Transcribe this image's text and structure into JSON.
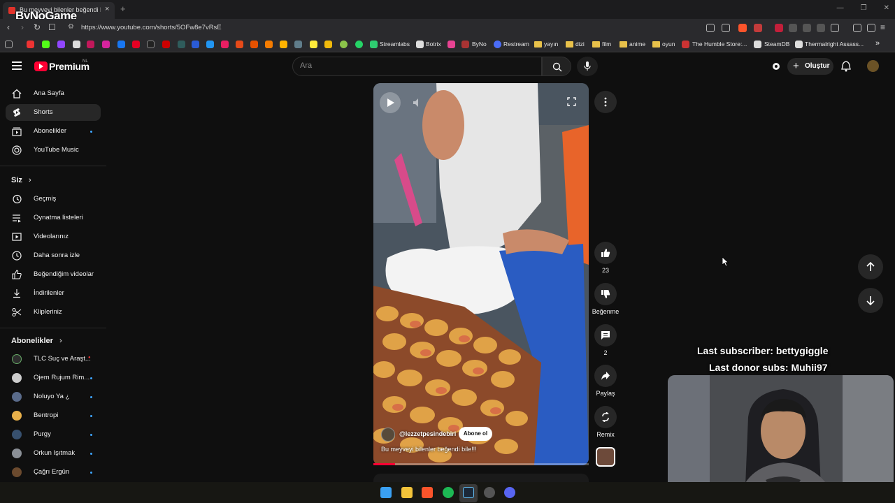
{
  "browser": {
    "tab_title": "Bu meyveyi bilenler beğendi bile!!! - YouTube",
    "tab_close": "×",
    "new_tab": "+",
    "overlay_brand": "ByNoGame",
    "url": "https://www.youtube.com/shorts/5OFw8e7vRsE",
    "window_controls": [
      "—",
      "❐",
      "✕"
    ]
  },
  "bookmarks": [
    {
      "label": "Streamlabs",
      "color": "#2ecc71"
    },
    {
      "label": "Botrix",
      "color": "#dddddd"
    },
    {
      "label": "ByNo",
      "color": "#e84393"
    },
    {
      "label": "Restream",
      "color": "#4a6cf7"
    },
    {
      "label": "yayın",
      "type": "folder"
    },
    {
      "label": "dizi",
      "type": "folder"
    },
    {
      "label": "film",
      "type": "folder"
    },
    {
      "label": "anime",
      "type": "folder"
    },
    {
      "label": "oyun",
      "type": "folder"
    },
    {
      "label": "The Humble Store:...",
      "color": "#cc3333"
    },
    {
      "label": "SteamDB",
      "color": "#dddddd"
    },
    {
      "label": "Thermalright Assass...",
      "color": "#dddddd"
    }
  ],
  "bookmarks_more": "»",
  "youtube": {
    "logo_text": "Premium",
    "logo_region": "NL",
    "search_placeholder": "Ara",
    "create_label": "Oluştur"
  },
  "sidebar": {
    "main": [
      {
        "label": "Ana Sayfa",
        "icon": "home-icon"
      },
      {
        "label": "Shorts",
        "icon": "shorts-icon",
        "active": true
      },
      {
        "label": "Abonelikler",
        "icon": "subscriptions-icon",
        "dot": true
      },
      {
        "label": "YouTube Music",
        "icon": "youtube-music-icon"
      }
    ],
    "you_heading": "Siz",
    "you": [
      {
        "label": "Geçmiş",
        "icon": "history-icon"
      },
      {
        "label": "Oynatma listeleri",
        "icon": "playlists-icon"
      },
      {
        "label": "Videolarınız",
        "icon": "your-videos-icon"
      },
      {
        "label": "Daha sonra izle",
        "icon": "watch-later-icon"
      },
      {
        "label": "Beğendiğim videolar",
        "icon": "liked-videos-icon"
      },
      {
        "label": "İndirilenler",
        "icon": "downloads-icon"
      },
      {
        "label": "Klipleriniz",
        "icon": "clips-icon"
      }
    ],
    "subs_heading": "Abonelikler",
    "subscriptions": [
      {
        "label": "TLC Suç ve Araşt...",
        "color": "#2d2d2d",
        "live": true
      },
      {
        "label": "Ojem Rujum Rim...",
        "color": "#cccccc",
        "dot": true
      },
      {
        "label": "Noluyo Ya ¿",
        "color": "#5a6b8a",
        "dot": true
      },
      {
        "label": "Bentropi",
        "color": "#e8b04a",
        "dot": true
      },
      {
        "label": "Purgy",
        "color": "#37506e",
        "dot": true
      },
      {
        "label": "Orkun Işıtmak",
        "color": "#8a8f96",
        "dot": true
      },
      {
        "label": "Çağrı Ergün",
        "color": "#6b4a2e",
        "dot": true
      }
    ]
  },
  "short": {
    "creator": "@lezzetpesindebiri",
    "subscribe": "Abone ol",
    "title": "Bu meyveyi bilenler beğendi bile!!!",
    "progress": 0.1
  },
  "actions": {
    "likes": "23",
    "dislike": "Beğenme",
    "comments": "2",
    "share": "Paylaş",
    "remix": "Remix"
  },
  "overlay": {
    "last_subscriber": "Last subscriber: bettygiggle",
    "last_donor": "Last donor subs: Muhii97"
  },
  "taskbar": [
    {
      "name": "windows-start-icon",
      "color": "#3aa0f3"
    },
    {
      "name": "file-explorer-icon",
      "color": "#f3c33a"
    },
    {
      "name": "brave-icon",
      "color": "#fb542b"
    },
    {
      "name": "spotify-icon",
      "color": "#1db954"
    },
    {
      "name": "steam-icon",
      "color": "#1b2838"
    },
    {
      "name": "obs-icon",
      "color": "#555555"
    },
    {
      "name": "discord-icon",
      "color": "#5865f2"
    }
  ]
}
